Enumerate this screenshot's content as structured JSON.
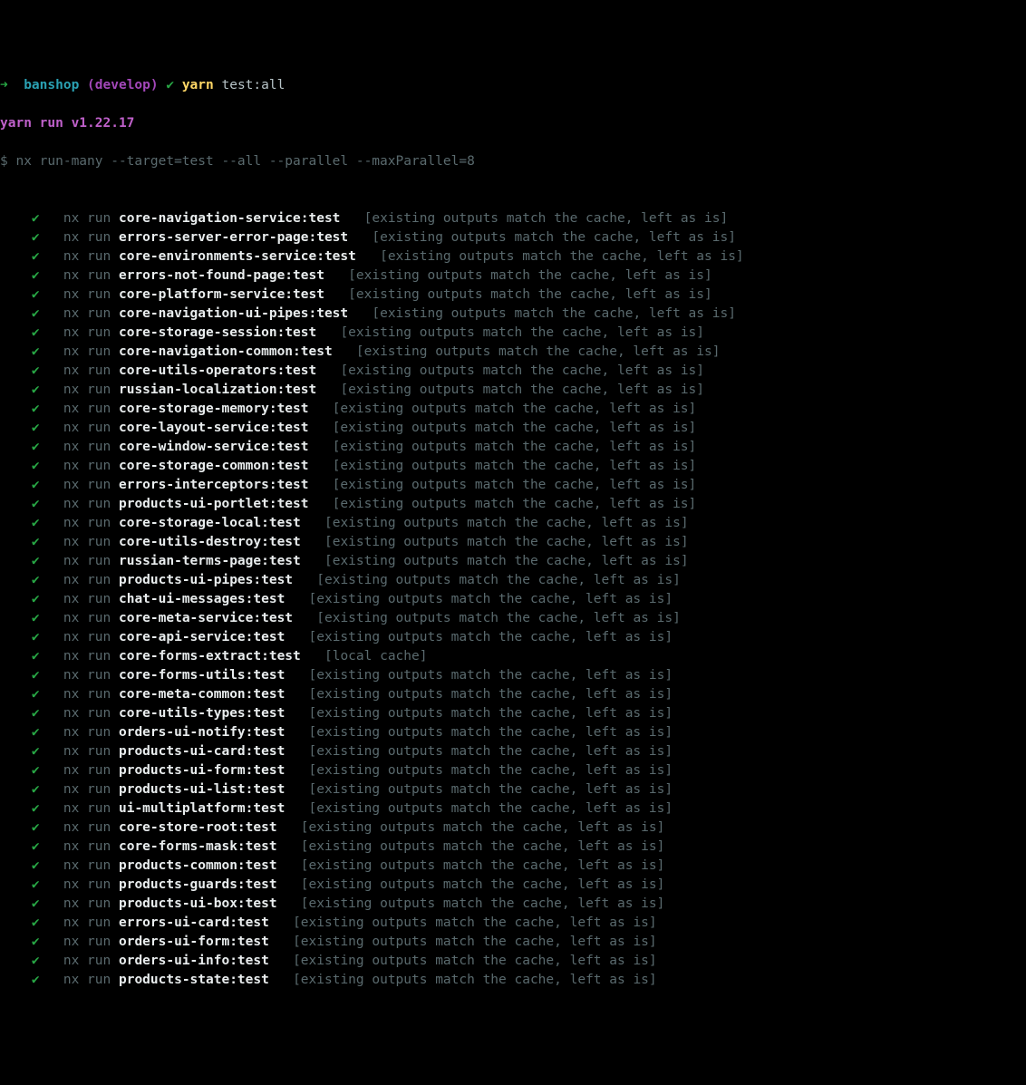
{
  "prompt": {
    "arrow": "➜",
    "dir": "banshop",
    "lparen": "(",
    "branch": "develop",
    "rparen": ")",
    "check": "✔",
    "cmd_tool": "yarn",
    "cmd_rest": "test:all"
  },
  "runner": {
    "banner": "yarn run v1.22.17",
    "cmd_prefix": "$ ",
    "cmd": "nx run-many --target=test --all --parallel --maxParallel=8"
  },
  "check": "✔",
  "nx_run": "nx run",
  "cache_msg": "[existing outputs match the cache, left as is]",
  "local_cache_msg": "[local cache]",
  "tasks": [
    {
      "name": "core-navigation-service:test",
      "msg": "cache"
    },
    {
      "name": "errors-server-error-page:test",
      "msg": "cache"
    },
    {
      "name": "core-environments-service:test",
      "msg": "cache"
    },
    {
      "name": "errors-not-found-page:test",
      "msg": "cache"
    },
    {
      "name": "core-platform-service:test",
      "msg": "cache"
    },
    {
      "name": "core-navigation-ui-pipes:test",
      "msg": "cache"
    },
    {
      "name": "core-storage-session:test",
      "msg": "cache"
    },
    {
      "name": "core-navigation-common:test",
      "msg": "cache"
    },
    {
      "name": "core-utils-operators:test",
      "msg": "cache"
    },
    {
      "name": "russian-localization:test",
      "msg": "cache"
    },
    {
      "name": "core-storage-memory:test",
      "msg": "cache"
    },
    {
      "name": "core-layout-service:test",
      "msg": "cache"
    },
    {
      "name": "core-window-service:test",
      "msg": "cache"
    },
    {
      "name": "core-storage-common:test",
      "msg": "cache"
    },
    {
      "name": "errors-interceptors:test",
      "msg": "cache"
    },
    {
      "name": "products-ui-portlet:test",
      "msg": "cache"
    },
    {
      "name": "core-storage-local:test",
      "msg": "cache"
    },
    {
      "name": "core-utils-destroy:test",
      "msg": "cache"
    },
    {
      "name": "russian-terms-page:test",
      "msg": "cache"
    },
    {
      "name": "products-ui-pipes:test",
      "msg": "cache"
    },
    {
      "name": "chat-ui-messages:test",
      "msg": "cache"
    },
    {
      "name": "core-meta-service:test",
      "msg": "cache"
    },
    {
      "name": "core-api-service:test",
      "msg": "cache"
    },
    {
      "name": "core-forms-extract:test",
      "msg": "local"
    },
    {
      "name": "core-forms-utils:test",
      "msg": "cache"
    },
    {
      "name": "core-meta-common:test",
      "msg": "cache"
    },
    {
      "name": "core-utils-types:test",
      "msg": "cache"
    },
    {
      "name": "orders-ui-notify:test",
      "msg": "cache"
    },
    {
      "name": "products-ui-card:test",
      "msg": "cache"
    },
    {
      "name": "products-ui-form:test",
      "msg": "cache"
    },
    {
      "name": "products-ui-list:test",
      "msg": "cache"
    },
    {
      "name": "ui-multiplatform:test",
      "msg": "cache"
    },
    {
      "name": "core-store-root:test",
      "msg": "cache"
    },
    {
      "name": "core-forms-mask:test",
      "msg": "cache"
    },
    {
      "name": "products-common:test",
      "msg": "cache"
    },
    {
      "name": "products-guards:test",
      "msg": "cache"
    },
    {
      "name": "products-ui-box:test",
      "msg": "cache"
    },
    {
      "name": "errors-ui-card:test",
      "msg": "cache"
    },
    {
      "name": "orders-ui-form:test",
      "msg": "cache"
    },
    {
      "name": "orders-ui-info:test",
      "msg": "cache"
    },
    {
      "name": "products-state:test",
      "msg": "cache"
    }
  ]
}
